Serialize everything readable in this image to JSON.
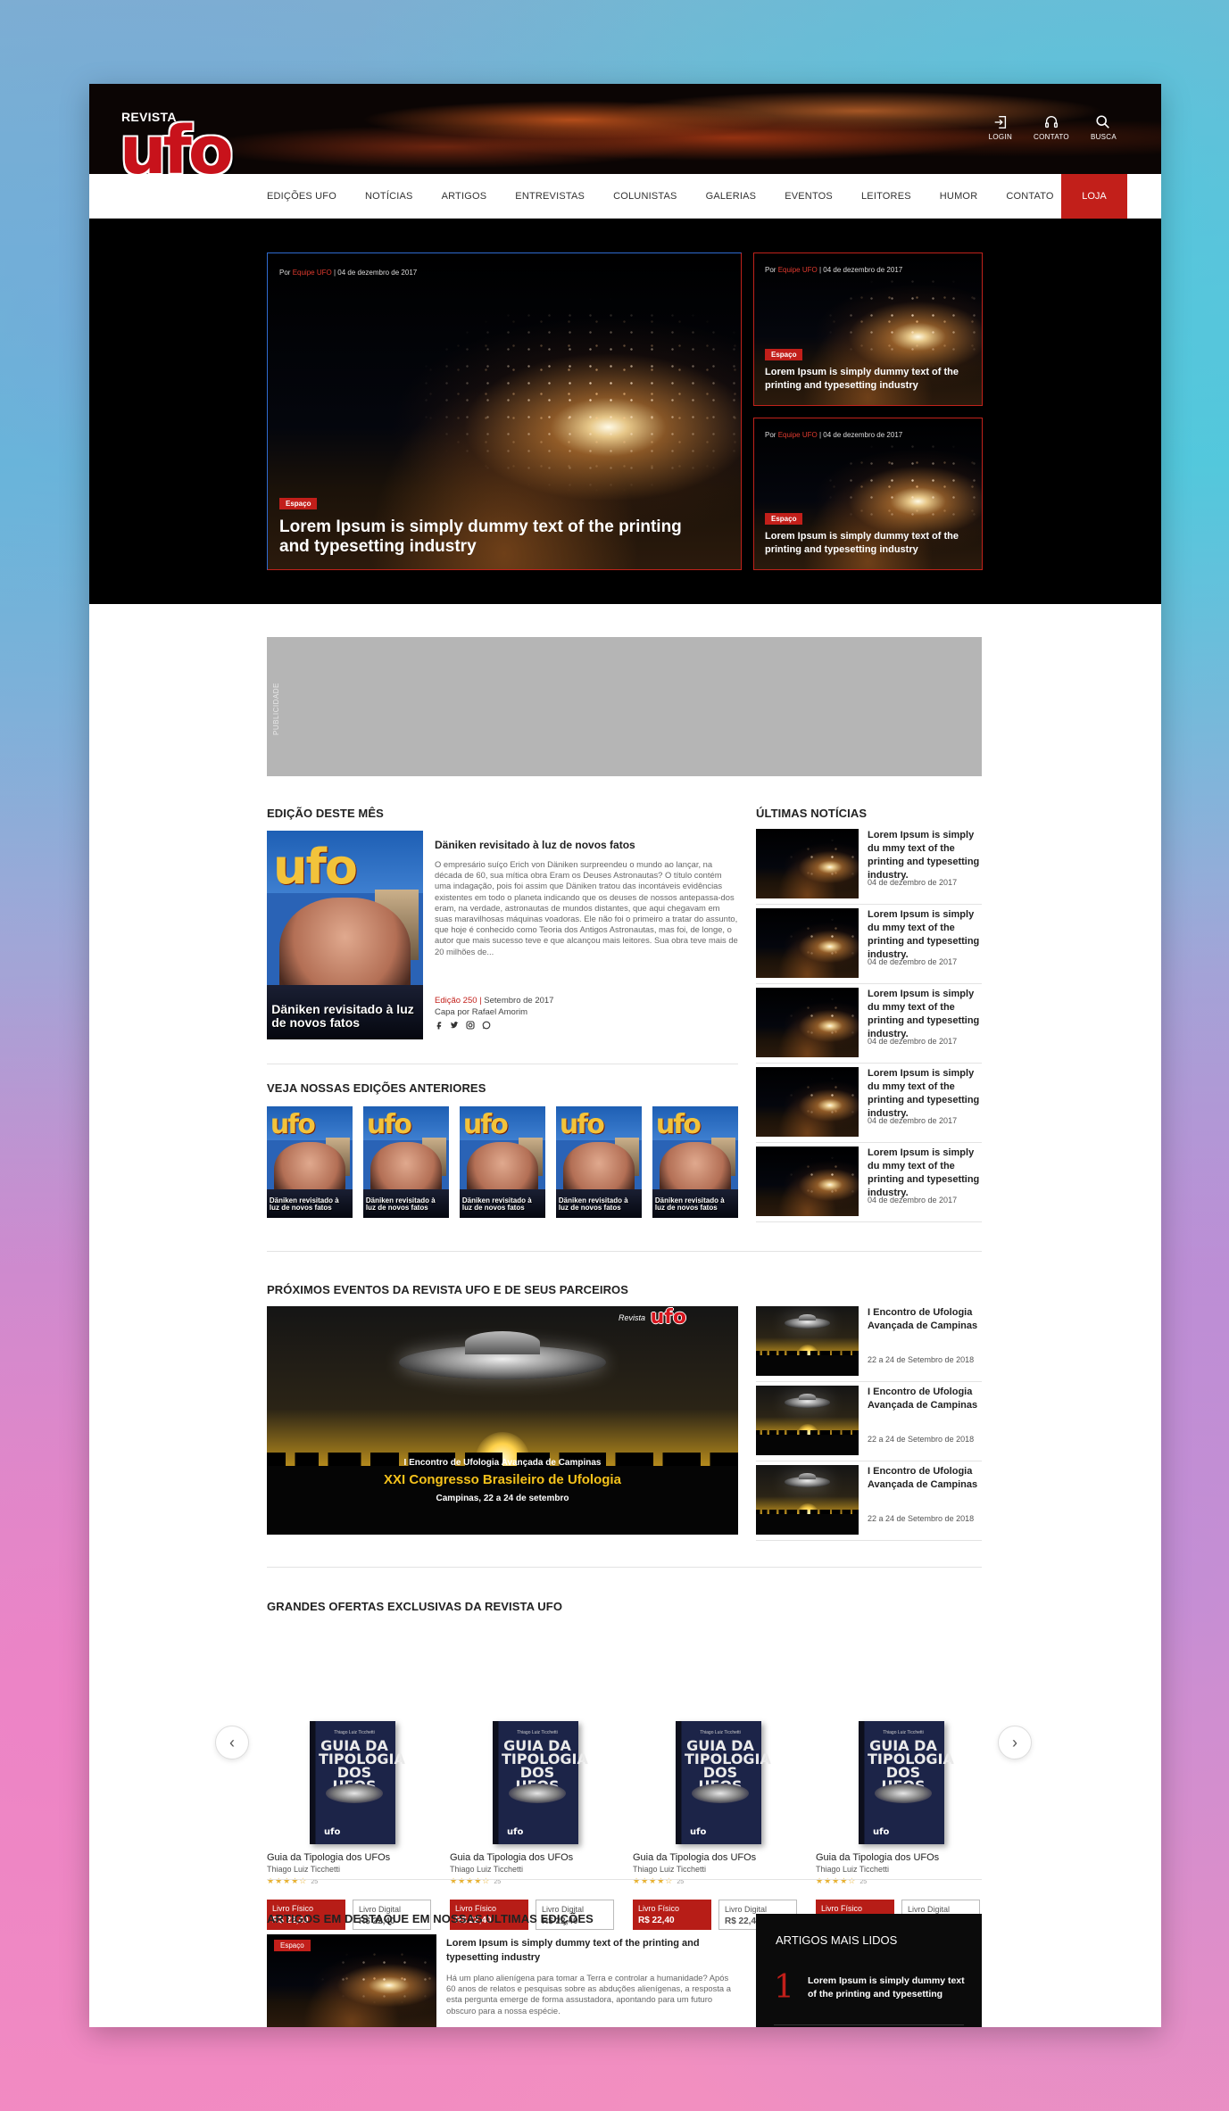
{
  "header": {
    "logo_top": "REVISTA",
    "logo_main": "ufo",
    "icons": [
      {
        "name": "login-icon",
        "label": "LOGIN"
      },
      {
        "name": "headset-icon",
        "label": "CONTATO"
      },
      {
        "name": "search-icon",
        "label": "BUSCA"
      }
    ]
  },
  "nav": {
    "items": [
      "EDIÇÕES UFO",
      "NOTÍCIAS",
      "ARTIGOS",
      "ENTREVISTAS",
      "COLUNISTAS",
      "GALERIAS",
      "EVENTOS",
      "LEITORES",
      "HUMOR",
      "CONTATO"
    ],
    "shop": "LOJA"
  },
  "hero": {
    "main": {
      "by_prefix": "Por",
      "author": "Equipe UFO",
      "sep": "|",
      "date": "04 de dezembro de 2017",
      "tag": "Espaço",
      "title": "Lorem Ipsum is simply dummy text of the printing and typesetting industry"
    },
    "side": [
      {
        "by_prefix": "Por",
        "author": "Equipe UFO",
        "sep": "|",
        "date": "04 de dezembro de 2017",
        "tag": "Espaço",
        "title": "Lorem Ipsum is simply dummy text of the printing and typesetting industry"
      },
      {
        "by_prefix": "Por",
        "author": "Equipe UFO",
        "sep": "|",
        "date": "04 de dezembro de 2017",
        "tag": "Espaço",
        "title": "Lorem Ipsum is simply dummy text of the printing and typesetting industry"
      }
    ]
  },
  "ad": {
    "label": "PUBLICIDADE"
  },
  "edition": {
    "section_title": "EDIÇÃO DESTE MÊS",
    "cover_caption": "Däniken revisitado à luz de novos fatos",
    "headline": "Däniken revisitado à luz de novos fatos",
    "body": "O empresário suíço Erich von Däniken surpreendeu o mundo ao lançar, na década de 60, sua mítica obra Eram os Deuses Astronautas? O título contém uma indagação, pois foi assim que Däniken tratou das incontáveis evidências existentes em todo o planeta indicando que os deuses de nossos antepassa-dos eram, na verdade, astronautas de mundos distantes, que aqui chegavam em suas maravilhosas máquinas voadoras. Ele não foi o primeiro a tratar do assunto, que hoje é conhecido como Teoria dos Antigos  Astronautas, mas foi, de longe, o autor que mais sucesso teve e que alcançou mais leitores. Sua obra teve mais de 20 milhões de...",
    "edition_label": "Edição 250",
    "sep": "|",
    "date": "Setembro de 2017",
    "cover_by": "Capa por Rafael Amorim",
    "social_icons": [
      "facebook-icon",
      "twitter-icon",
      "instagram-icon",
      "whatsapp-icon"
    ]
  },
  "previous": {
    "section_title": "VEJA NOSSAS EDIÇÕES ANTERIORES",
    "covers": [
      {
        "title": "ufo",
        "caption": "Däniken revisitado à luz de novos fatos"
      },
      {
        "title": "ufo",
        "caption": "Däniken revisitado à luz de novos fatos"
      },
      {
        "title": "ufo",
        "caption": "Däniken revisitado à luz de novos fatos"
      },
      {
        "title": "ufo",
        "caption": "Däniken revisitado à luz de novos fatos"
      },
      {
        "title": "ufo",
        "caption": "Däniken revisitado à luz de novos fatos"
      }
    ]
  },
  "latest": {
    "section_title": "ÚLTIMAS NOTÍCIAS",
    "items": [
      {
        "title": "Lorem Ipsum is simply du mmy text of the printing and typesetting industry.",
        "date": "04 de dezembro de 2017"
      },
      {
        "title": "Lorem Ipsum is simply du mmy text of the printing and typesetting industry.",
        "date": "04 de dezembro de 2017"
      },
      {
        "title": "Lorem Ipsum is simply du mmy text of the printing and typesetting industry.",
        "date": "04 de dezembro de 2017"
      },
      {
        "title": "Lorem Ipsum is simply du mmy text of the printing and typesetting industry.",
        "date": "04 de dezembro de 2017"
      },
      {
        "title": "Lorem Ipsum is simply du mmy text of the printing and typesetting industry.",
        "date": "04 de dezembro de 2017"
      }
    ]
  },
  "events": {
    "section_title": "PRÓXIMOS EVENTOS DA REVISTA UFO E DE SEUS PARCEIROS",
    "banner": {
      "brand_small": "Revista",
      "brand": "ufo",
      "line1": "I Encontro de Ufologia Avançada de Campinas",
      "line2": "XXI Congresso Brasileiro de Ufologia",
      "line3": "Campinas, 22 a 24 de setembro"
    },
    "items": [
      {
        "title": "I Encontro de Ufologia Avançada de Campinas",
        "date": "22 a 24 de Setembro de 2018"
      },
      {
        "title": "I Encontro de Ufologia Avançada de Campinas",
        "date": "22 a 24 de Setembro de 2018"
      },
      {
        "title": "I Encontro de Ufologia Avançada de Campinas",
        "date": "22 a 24 de Setembro de 2018"
      }
    ]
  },
  "offers": {
    "section_title": "GRANDES OFERTAS EXCLUSIVAS DA REVISTA UFO",
    "prev": "‹",
    "next": "›",
    "products": [
      {
        "cover_small": "Thiago Luiz Ticchetti",
        "cover_title": "GUIA DA TIPOLOGIA DOS UFOS",
        "cover_logo": "ufo",
        "name": "Guia da Tipologia dos UFOs",
        "author": "Thiago Luiz Ticchetti",
        "stars": "★★★★☆",
        "rating_count": "25",
        "physical_label": "Livro Físico",
        "physical_price": "R$ 22,40",
        "digital_label": "Livro Digital",
        "digital_price": "R$ 22,40"
      },
      {
        "cover_small": "Thiago Luiz Ticchetti",
        "cover_title": "GUIA DA TIPOLOGIA DOS UFOS",
        "cover_logo": "ufo",
        "name": "Guia da Tipologia dos UFOs",
        "author": "Thiago Luiz Ticchetti",
        "stars": "★★★★☆",
        "rating_count": "25",
        "physical_label": "Livro Físico",
        "physical_price": "R$ 22,40",
        "digital_label": "Livro Digital",
        "digital_price": "R$ 22,40"
      },
      {
        "cover_small": "Thiago Luiz Ticchetti",
        "cover_title": "GUIA DA TIPOLOGIA DOS UFOS",
        "cover_logo": "ufo",
        "name": "Guia da Tipologia dos UFOs",
        "author": "Thiago Luiz Ticchetti",
        "stars": "★★★★☆",
        "rating_count": "25",
        "physical_label": "Livro Físico",
        "physical_price": "R$ 22,40",
        "digital_label": "Livro Digital",
        "digital_price": "R$ 22,40"
      },
      {
        "cover_small": "Thiago Luiz Ticchetti",
        "cover_title": "GUIA DA TIPOLOGIA DOS UFOS",
        "cover_logo": "ufo",
        "name": "Guia da Tipologia dos UFOs",
        "author": "Thiago Luiz Ticchetti",
        "stars": "★★★★☆",
        "rating_count": "25",
        "physical_label": "Livro Físico",
        "physical_price": "R$ 22,40",
        "digital_label": "Livro Digital",
        "digital_price": "R$ 22,40"
      }
    ]
  },
  "featured": {
    "section_title": "ARTIGOS EM DESTAQUE EM NOSSAS ULTIMAS EDIÇÕES",
    "tag": "Espaço",
    "title": "Lorem Ipsum is simply dummy text of the printing and typesetting industry",
    "body": "Há um plano alienígena para tomar a Terra e controlar a humanidade? Após 60 anos de relatos e pesquisas sobre as abduções alienígenas, a resposta a esta pergunta emerge de forma assustadora, apontando para um futuro obscuro para a nossa espécie."
  },
  "most_read": {
    "section_title": "ARTIGOS MAIS LIDOS",
    "items": [
      {
        "rank": "1",
        "title": "Lorem Ipsum is simply dummy text of the printing and typesetting"
      }
    ]
  },
  "colors": {
    "accent": "#c21f1a",
    "header_bg": "#0b0504",
    "star": "#e7b131"
  }
}
